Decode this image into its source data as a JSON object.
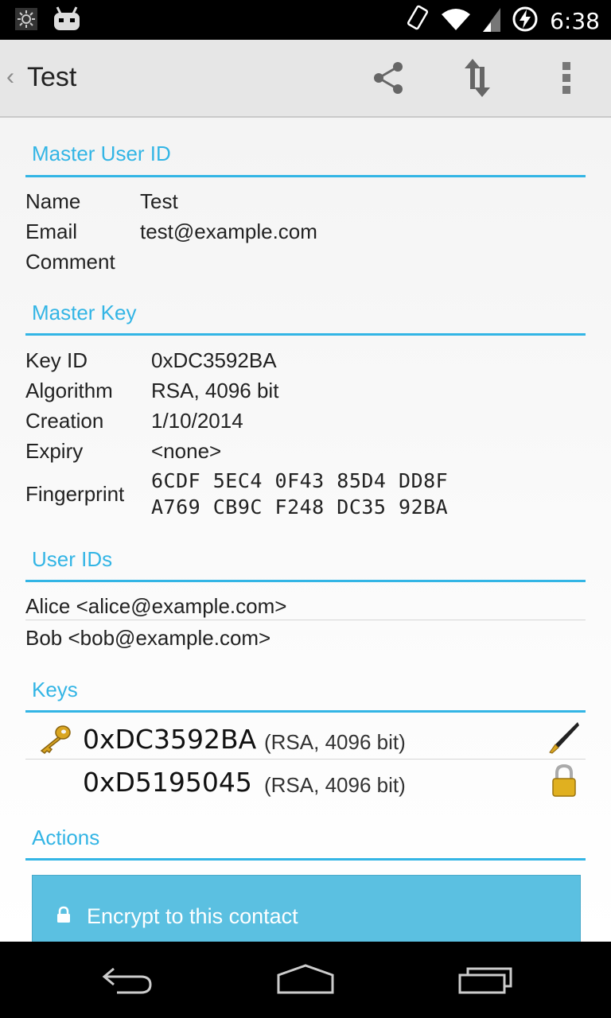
{
  "status": {
    "time": "6:38"
  },
  "actionbar": {
    "title": "Test",
    "icons": [
      "share-icon",
      "sync-icon",
      "overflow-menu-icon"
    ]
  },
  "master_user_id": {
    "heading": "Master User ID",
    "rows": [
      {
        "label": "Name",
        "value": "Test"
      },
      {
        "label": "Email",
        "value": "test@example.com"
      },
      {
        "label": "Comment",
        "value": ""
      }
    ]
  },
  "master_key": {
    "heading": "Master Key",
    "rows": [
      {
        "label": "Key ID",
        "value": "0xDC3592BA"
      },
      {
        "label": "Algorithm",
        "value": "RSA, 4096 bit"
      },
      {
        "label": "Creation",
        "value": "1/10/2014"
      },
      {
        "label": "Expiry",
        "value": "<none>"
      },
      {
        "label": "Fingerprint",
        "value_line1": "6CDF 5EC4 0F43 85D4 DD8F",
        "value_line2": "A769 CB9C F248 DC35 92BA"
      }
    ]
  },
  "user_ids": {
    "heading": "User IDs",
    "items": [
      "Alice <alice@example.com>",
      "Bob <bob@example.com>"
    ]
  },
  "keys": {
    "heading": "Keys",
    "items": [
      {
        "id": "0xDC3592BA",
        "info": "(RSA, 4096 bit)",
        "left_icon": "key-icon",
        "right_icon": "pen-icon"
      },
      {
        "id": "0xD5195045",
        "info": "(RSA, 4096 bit)",
        "left_icon": "",
        "right_icon": "lock-icon"
      }
    ]
  },
  "actions": {
    "heading": "Actions",
    "encrypt_label": "Encrypt to this contact"
  },
  "colors": {
    "accent": "#33b5e5",
    "button": "#5bc0e1"
  }
}
